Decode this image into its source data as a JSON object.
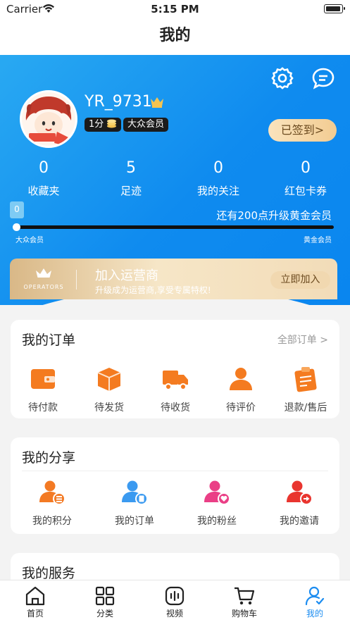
{
  "status_bar": {
    "carrier": "Carrier",
    "time": "5:15 PM"
  },
  "nav": {
    "title": "我的"
  },
  "profile": {
    "username": "YR_9731",
    "points_badge": "1分",
    "member_badge": "大众会员",
    "signin_label": "已签到>"
  },
  "stats": [
    {
      "value": "0",
      "label": "收藏夹"
    },
    {
      "value": "5",
      "label": "足迹"
    },
    {
      "value": "0",
      "label": "我的关注"
    },
    {
      "value": "0",
      "label": "红包卡券"
    }
  ],
  "level": {
    "current_points": "0",
    "progress": 0,
    "upgrade_tip": "还有200点升级黄金会员",
    "start_label": "大众会员",
    "end_label": "黄金会员"
  },
  "operator": {
    "logo_text": "OPERATORS",
    "title": "加入运营商",
    "subtitle": "升级成为运营商,享受专属特权!",
    "join_label": "立即加入"
  },
  "orders": {
    "title": "我的订单",
    "more_label": "全部订单 >",
    "items": [
      {
        "label": "待付款",
        "icon": "wallet-icon"
      },
      {
        "label": "待发货",
        "icon": "box-icon"
      },
      {
        "label": "待收货",
        "icon": "truck-icon"
      },
      {
        "label": "待评价",
        "icon": "user-review-icon"
      },
      {
        "label": "退款/售后",
        "icon": "clipboard-icon"
      }
    ]
  },
  "share": {
    "title": "我的分享",
    "items": [
      {
        "label": "我的积分",
        "icon": "user-points-icon",
        "color": "#f37a24"
      },
      {
        "label": "我的订单",
        "icon": "user-order-icon",
        "color": "#3b9af0"
      },
      {
        "label": "我的粉丝",
        "icon": "user-fans-icon",
        "color": "#ea3f86"
      },
      {
        "label": "我的邀请",
        "icon": "user-invite-icon",
        "color": "#e9352f"
      }
    ]
  },
  "services": {
    "title": "我的服务"
  },
  "tabbar": [
    {
      "label": "首页",
      "icon": "home-icon"
    },
    {
      "label": "分类",
      "icon": "category-icon"
    },
    {
      "label": "视频",
      "icon": "video-icon"
    },
    {
      "label": "购物车",
      "icon": "cart-icon"
    },
    {
      "label": "我的",
      "icon": "profile-icon"
    }
  ],
  "colors": {
    "accent": "#1b8cf0",
    "order_orange": "#f47b20",
    "gold": "#d9b887"
  }
}
